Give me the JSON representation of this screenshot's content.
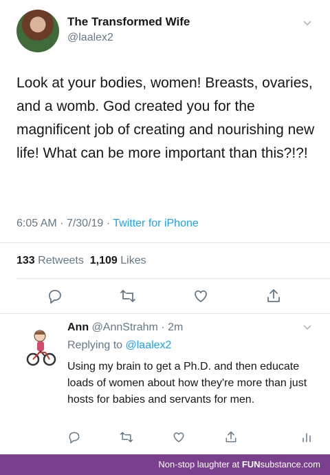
{
  "tweet": {
    "author_name": "The Transformed Wife",
    "author_handle": "@laalex2",
    "text": "Look at your bodies, women! Breasts, ovaries, and a womb. God created you for the magnificent job of creating and nourishing new life! What can be more important than this?!?!",
    "time": "6:05 AM",
    "date": "7/30/19",
    "source": "Twitter for iPhone",
    "retweets_count": "133",
    "retweets_label": "Retweets",
    "likes_count": "1,109",
    "likes_label": "Likes"
  },
  "reply": {
    "name": "Ann",
    "handle": "@AnnStrahm",
    "age": "2m",
    "replying_label": "Replying to",
    "replying_handle": "@laalex2",
    "text": "Using my brain to get a Ph.D. and then educate loads of women about how they're more than just hosts for babies and servants for men."
  },
  "banner": {
    "text": "Non-stop laughter at",
    "brand_bold": "FUN",
    "brand_rest": "substance.com",
    "color": "#7a3f8d"
  },
  "colors": {
    "link": "#1da1f2",
    "muted": "#657786",
    "text": "#14171a"
  },
  "icons": [
    "reply-icon",
    "retweet-icon",
    "like-icon",
    "share-icon",
    "analytics-icon",
    "chevron-down-icon"
  ]
}
